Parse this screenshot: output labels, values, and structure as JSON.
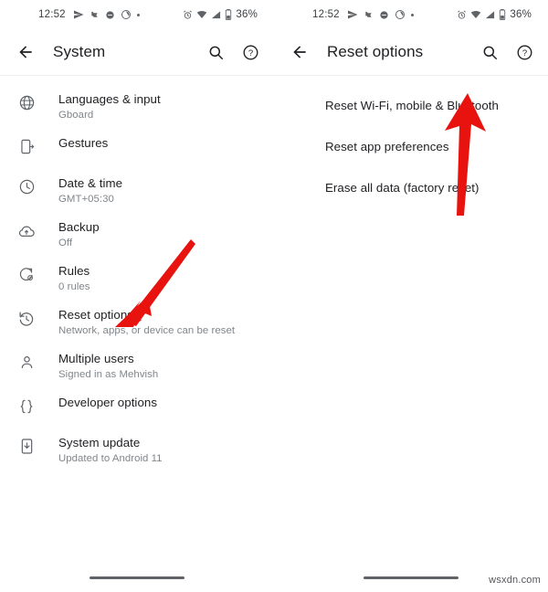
{
  "colors": {
    "accent_arrow": "#e8130f",
    "text_primary": "#202124",
    "text_secondary": "#80868b",
    "icon": "#5f6368",
    "divider": "#eceff1",
    "background": "#ffffff"
  },
  "panels": [
    {
      "id": "system-screen",
      "statusbar": {
        "time": "12:52",
        "battery": "36%",
        "left_icons": [
          "send-icon",
          "flag-icon",
          "minus-circle-icon",
          "clock-circle-icon",
          "dot-icon"
        ],
        "right_icons": [
          "alarm-icon",
          "wifi-icon",
          "signal-icon",
          "battery-icon"
        ]
      },
      "toolbar": {
        "back_label": "back-arrow",
        "title": "System",
        "actions": [
          "search-icon",
          "help-icon"
        ]
      },
      "list": [
        {
          "icon": "globe-icon",
          "title": "Languages & input",
          "subtitle": "Gboard"
        },
        {
          "icon": "gestures-icon",
          "title": "Gestures",
          "subtitle": ""
        },
        {
          "icon": "clock-icon",
          "title": "Date & time",
          "subtitle": "GMT+05:30"
        },
        {
          "icon": "cloud-upload-icon",
          "title": "Backup",
          "subtitle": "Off"
        },
        {
          "icon": "rules-icon",
          "title": "Rules",
          "subtitle": "0 rules"
        },
        {
          "icon": "history-icon",
          "title": "Reset options",
          "subtitle": "Network, apps, or device can be reset"
        },
        {
          "icon": "person-icon",
          "title": "Multiple users",
          "subtitle": "Signed in as Mehvish"
        },
        {
          "icon": "braces-icon",
          "title": "Developer options",
          "subtitle": ""
        },
        {
          "icon": "system-update-icon",
          "title": "System update",
          "subtitle": "Updated to Android 11"
        }
      ]
    },
    {
      "id": "reset-options-screen",
      "statusbar": {
        "time": "12:52",
        "battery": "36%",
        "left_icons": [
          "send-icon",
          "flag-icon",
          "minus-circle-icon",
          "clock-circle-icon",
          "dot-icon"
        ],
        "right_icons": [
          "alarm-icon",
          "wifi-icon",
          "signal-icon",
          "battery-icon"
        ]
      },
      "toolbar": {
        "back_label": "back-arrow",
        "title": "Reset options",
        "actions": [
          "search-icon",
          "help-icon"
        ]
      },
      "list": [
        {
          "icon": "",
          "title": "Reset Wi-Fi, mobile & Bluetooth",
          "subtitle": ""
        },
        {
          "icon": "",
          "title": "Reset app preferences",
          "subtitle": ""
        },
        {
          "icon": "",
          "title": "Erase all data (factory reset)",
          "subtitle": ""
        }
      ]
    }
  ],
  "annotations": {
    "arrow_left": "red-arrow-pointing-to-reset-options",
    "arrow_right": "red-arrow-pointing-to-reset-wifi-mobile-bluetooth"
  },
  "watermark": "wsxdn.com"
}
